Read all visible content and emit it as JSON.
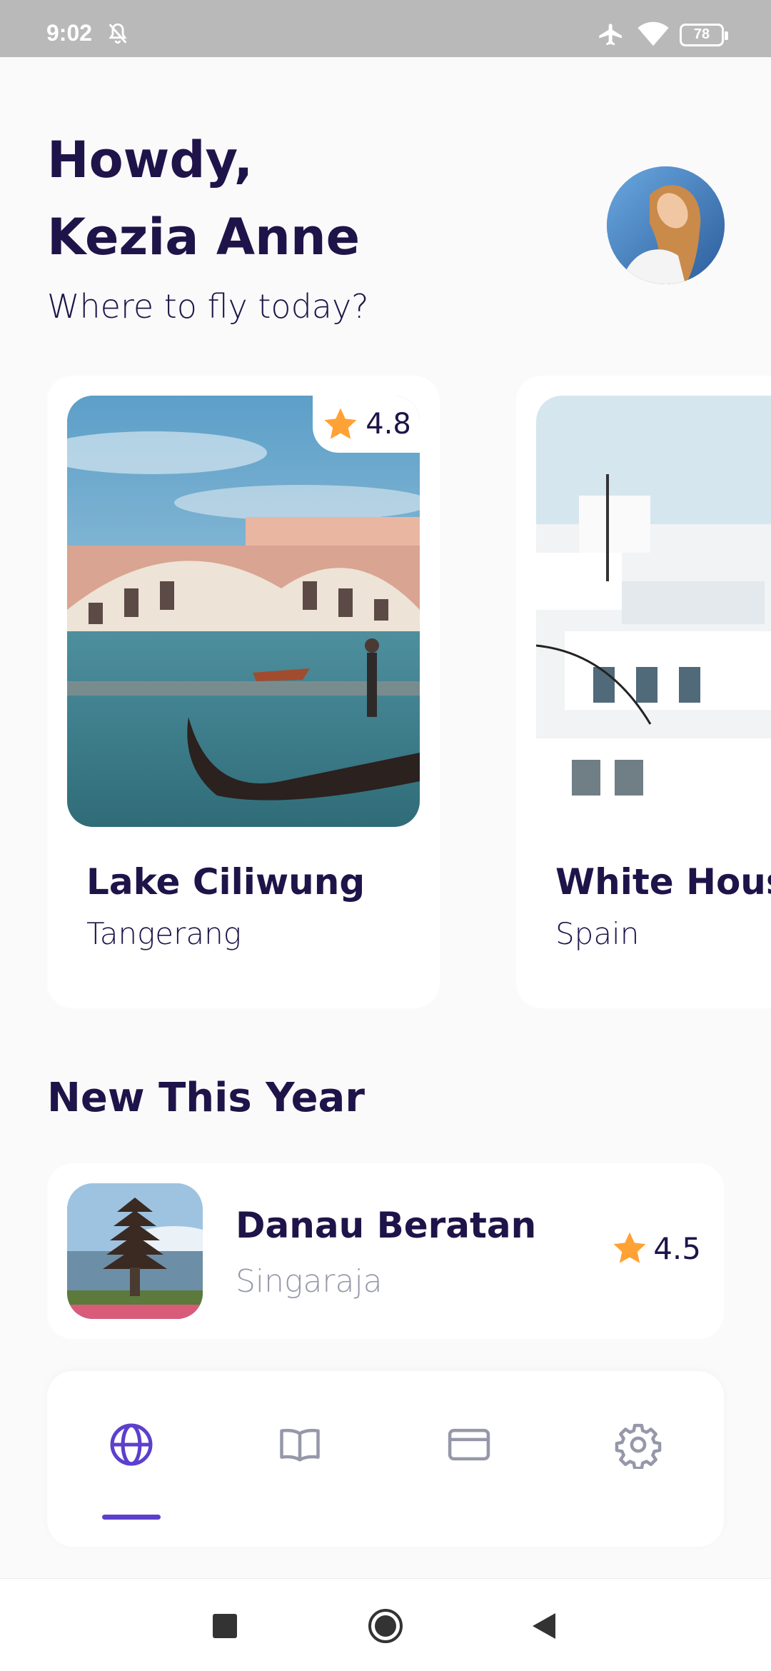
{
  "status_bar": {
    "time": "9:02",
    "battery": "78"
  },
  "header": {
    "greeting_line1": "Howdy,",
    "greeting_line2": "Kezia Anne",
    "subtitle": "Where to fly today?"
  },
  "destinations": [
    {
      "name": "Lake Ciliwung",
      "city": "Tangerang",
      "rating": "4.8"
    },
    {
      "name": "White House",
      "city": "Spain",
      "rating": ""
    }
  ],
  "new_this_year": {
    "title": "New This Year",
    "items": [
      {
        "name": "Danau Beratan",
        "city": "Singaraja",
        "rating": "4.5"
      }
    ]
  },
  "tabbar": {
    "tabs": [
      {
        "icon": "globe-icon",
        "active": true
      },
      {
        "icon": "book-icon",
        "active": false
      },
      {
        "icon": "card-icon",
        "active": false
      },
      {
        "icon": "gear-icon",
        "active": false
      }
    ]
  },
  "colors": {
    "primary_text": "#1F1449",
    "secondary_text": "#9698A9",
    "accent": "#5C40CC",
    "star": "#FFA235",
    "background": "#FAFAFA"
  }
}
